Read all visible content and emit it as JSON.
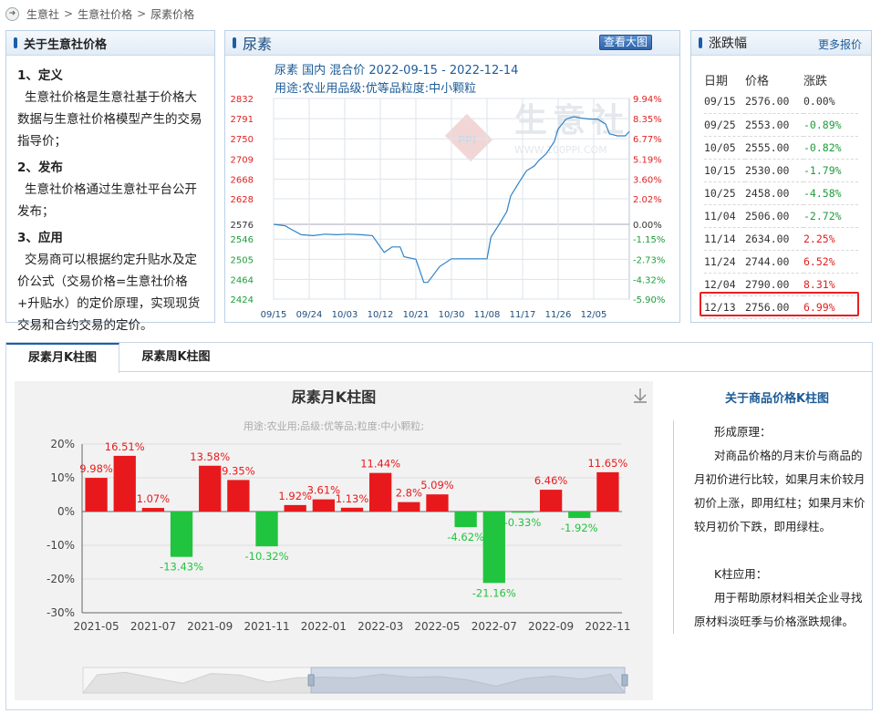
{
  "breadcrumb": [
    "生意社",
    "生意社价格",
    "尿素价格"
  ],
  "about": {
    "title": "关于生意社价格",
    "sections": [
      {
        "heading": "1、定义",
        "text": "生意社价格是生意社基于价格大数据与生意社价格模型产生的交易指导价；"
      },
      {
        "heading": "2、发布",
        "text": "生意社价格通过生意社平台公开发布；"
      },
      {
        "heading": "3、应用",
        "text": "交易商可以根据约定升贴水及定价公式（交易价格=生意社价格+升贴水）的定价原理，实现现货交易和合约交易的定价。"
      }
    ]
  },
  "price_chart": {
    "panel_title": "尿素",
    "big_button": "查看大图",
    "title": "尿素 国内 混合价 2022-09-15 - 2022-12-14",
    "usage": "用途:农业用品级:优等品粒度:中小颗粒",
    "watermark": "生意社",
    "watermark_url": "WWW.100PPI.COM",
    "watermark_logo": "PPI",
    "colors": {
      "line": "#2e82c8",
      "up": "#e02020",
      "down": "#1e9c3a"
    }
  },
  "change": {
    "title": "涨跌幅",
    "more": "更多报价",
    "headers": [
      "日期",
      "价格",
      "涨跌"
    ],
    "rows": [
      {
        "date": "09/15",
        "price": "2576.00",
        "change": "0.00%",
        "dir": "zero"
      },
      {
        "date": "09/25",
        "price": "2553.00",
        "change": "-0.89%",
        "dir": "dn"
      },
      {
        "date": "10/05",
        "price": "2555.00",
        "change": "-0.82%",
        "dir": "dn"
      },
      {
        "date": "10/15",
        "price": "2530.00",
        "change": "-1.79%",
        "dir": "dn"
      },
      {
        "date": "10/25",
        "price": "2458.00",
        "change": "-4.58%",
        "dir": "dn"
      },
      {
        "date": "11/04",
        "price": "2506.00",
        "change": "-2.72%",
        "dir": "dn"
      },
      {
        "date": "11/14",
        "price": "2634.00",
        "change": "2.25%",
        "dir": "up"
      },
      {
        "date": "11/24",
        "price": "2744.00",
        "change": "6.52%",
        "dir": "up"
      },
      {
        "date": "12/04",
        "price": "2790.00",
        "change": "8.31%",
        "dir": "up"
      },
      {
        "date": "12/13",
        "price": "2756.00",
        "change": "6.99%",
        "dir": "up"
      }
    ]
  },
  "tabs": [
    "尿素月K柱图",
    "尿素周K柱图"
  ],
  "kchart": {
    "title": "尿素月K柱图",
    "subtitle": "用途:农业用;品级:优等品;粒度:中小颗粒;"
  },
  "side": {
    "title": "关于商品价格K柱图",
    "p1_title": "形成原理：",
    "p1": "对商品价格的月末价与商品的月初价进行比较，如果月末价较月初价上涨，即用红柱；如果月末价较月初价下跌，即用绿柱。",
    "p2_title": "K柱应用：",
    "p2": "用于帮助原材料相关企业寻找原材料淡旺季与价格涨跌规律。"
  },
  "chart_data": [
    {
      "type": "line",
      "title": "尿素 国内 混合价 2022-09-15 - 2022-12-14",
      "x_ticks": [
        "09/15",
        "09/24",
        "10/03",
        "10/12",
        "10/21",
        "10/30",
        "11/08",
        "11/17",
        "11/26",
        "12/05"
      ],
      "y_left_ticks": [
        2832,
        2791,
        2750,
        2709,
        2668,
        2628,
        2576,
        2546,
        2505,
        2464,
        2424
      ],
      "y_right_ticks": [
        "9.94%",
        "8.35%",
        "6.77%",
        "5.19%",
        "3.60%",
        "2.02%",
        "0.00%",
        "-1.15%",
        "-2.73%",
        "-4.32%",
        "-5.90%"
      ],
      "ylim": [
        2424,
        2832
      ],
      "xlim": [
        "09/15",
        "12/14"
      ],
      "series": [
        {
          "x": [
            "09/15",
            "09/18",
            "09/19",
            "09/22",
            "09/25",
            "09/28",
            "10/01",
            "10/04",
            "10/07",
            "10/10",
            "10/13",
            "10/15",
            "10/17",
            "10/18",
            "10/21",
            "10/23",
            "10/24",
            "10/27",
            "10/30",
            "11/02",
            "11/05",
            "11/07",
            "11/08",
            "11/09",
            "11/11",
            "11/13",
            "11/14",
            "11/16",
            "11/18",
            "11/20",
            "11/21",
            "11/23",
            "11/25",
            "11/26",
            "11/28",
            "11/30",
            "12/02",
            "12/04",
            "12/06",
            "12/08",
            "12/09",
            "12/11",
            "12/13",
            "12/14"
          ],
          "y": [
            2576,
            2573,
            2568,
            2555,
            2553,
            2556,
            2555,
            2556,
            2555,
            2553,
            2519,
            2530,
            2530,
            2510,
            2505,
            2458,
            2458,
            2490,
            2506,
            2506,
            2506,
            2506,
            2506,
            2550,
            2575,
            2602,
            2634,
            2660,
            2685,
            2695,
            2705,
            2720,
            2744,
            2770,
            2790,
            2795,
            2792,
            2790,
            2790,
            2780,
            2760,
            2756,
            2756,
            2765
          ]
        }
      ]
    },
    {
      "type": "bar",
      "title": "尿素月K柱图",
      "categories": [
        "2021-05",
        "2021-06",
        "2021-07",
        "2021-08",
        "2021-09",
        "2021-10",
        "2021-11",
        "2021-12",
        "2022-01",
        "2022-02",
        "2022-03",
        "2022-04",
        "2022-05",
        "2022-06",
        "2022-07",
        "2022-08",
        "2022-09",
        "2022-10",
        "2022-11"
      ],
      "x_tick_labels": [
        "2021-05",
        "2021-07",
        "2021-09",
        "2021-11",
        "2022-01",
        "2022-03",
        "2022-05",
        "2022-07",
        "2022-09",
        "2022-11"
      ],
      "values": [
        9.98,
        16.51,
        1.07,
        -13.43,
        13.58,
        9.35,
        -10.32,
        1.92,
        3.61,
        1.13,
        11.44,
        2.8,
        5.09,
        -4.62,
        -21.16,
        -0.33,
        6.46,
        -1.92,
        11.65
      ],
      "labels": [
        "9.98%",
        "16.51%",
        "1.07%",
        "-13.43%",
        "13.58%",
        "9.35%",
        "-10.32%",
        "1.92%",
        "3.61%",
        "1.13%",
        "11.44%",
        "2.8%",
        "5.09%",
        "-4.62%",
        "-21.16%",
        "-0.33%",
        "6.46%",
        "-1.92%",
        "11.65%"
      ],
      "y_tick_labels": [
        "20%",
        "10%",
        "0%",
        "-10%",
        "-20%",
        "-30%"
      ],
      "ylim": [
        -30,
        20
      ],
      "colors": {
        "up": "#e8191c",
        "down": "#21c43e"
      }
    }
  ]
}
